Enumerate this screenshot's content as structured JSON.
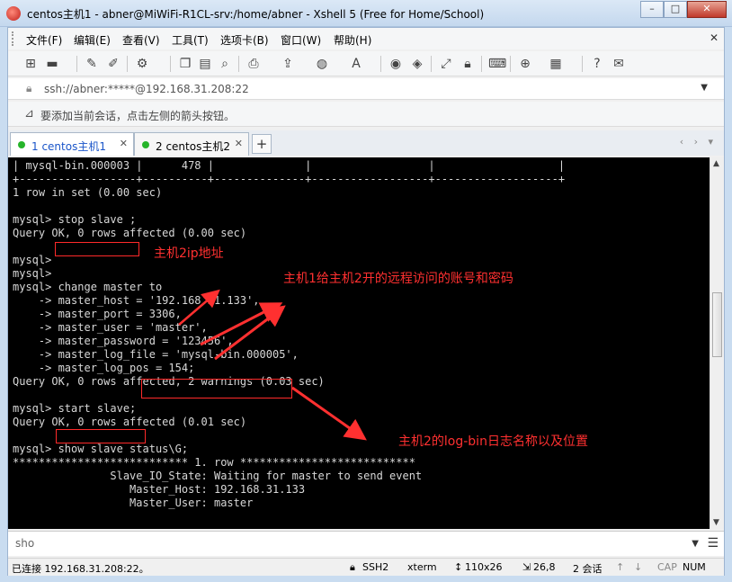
{
  "window": {
    "title": "centos主机1 - abner@MiWiFi-R1CL-srv:/home/abner - Xshell 5 (Free for Home/School)",
    "minimize": "–",
    "maximize": "□",
    "close": "✕"
  },
  "menu": [
    {
      "label": "文件(F)"
    },
    {
      "label": "编辑(E)"
    },
    {
      "label": "查看(V)"
    },
    {
      "label": "工具(T)"
    },
    {
      "label": "选项卡(B)"
    },
    {
      "label": "窗口(W)"
    },
    {
      "label": "帮助(H)"
    }
  ],
  "menu_close": "✕",
  "address": {
    "value": "ssh://abner:*****@192.168.31.208:22"
  },
  "hint": {
    "text": "要添加当前会话，点击左侧的箭头按钮。"
  },
  "tabs": [
    {
      "label": "1 centos主机1",
      "active": true
    },
    {
      "label": "2 centos主机2",
      "active": false
    }
  ],
  "tab_add": "+",
  "tab_nav": "‹ › ▾",
  "terminal": {
    "lines": [
      "| mysql-bin.000003 |      478 |              |                  |                   |",
      "+------------------+----------+--------------+------------------+-------------------+",
      "1 row in set (0.00 sec)",
      "",
      "mysql> stop slave ;",
      "Query OK, 0 rows affected (0.00 sec)",
      "",
      "mysql>",
      "mysql>",
      "mysql> change master to",
      "    -> master_host = '192.168.31.133',",
      "    -> master_port = 3306,",
      "    -> master_user = 'master',",
      "    -> master_password = '123456',",
      "    -> master_log_file = 'mysql-bin.000005',",
      "    -> master_log_pos = 154;",
      "Query OK, 0 rows affected, 2 warnings (0.03 sec)",
      "",
      "mysql> start slave;",
      "Query OK, 0 rows affected (0.01 sec)",
      "",
      "mysql> show slave status\\G;",
      "*************************** 1. row ***************************",
      "               Slave_IO_State: Waiting for master to send event",
      "                  Master_Host: 192.168.31.133",
      "                  Master_User: master"
    ]
  },
  "annotations": {
    "host_ip": "主机2ip地址",
    "account": "主机1给主机2开的远程访问的账号和密码",
    "logbin": "主机2的log-bin日志名称以及位置",
    "color": "#ff3030"
  },
  "input": {
    "value": "sho"
  },
  "status": {
    "connection": "已连接 192.168.31.208:22。",
    "protocol": "SSH2",
    "term": "xterm",
    "size": "110x26",
    "cursor": "26,8",
    "sessions": "2 会话",
    "caps": "CAP",
    "num": "NUM"
  }
}
